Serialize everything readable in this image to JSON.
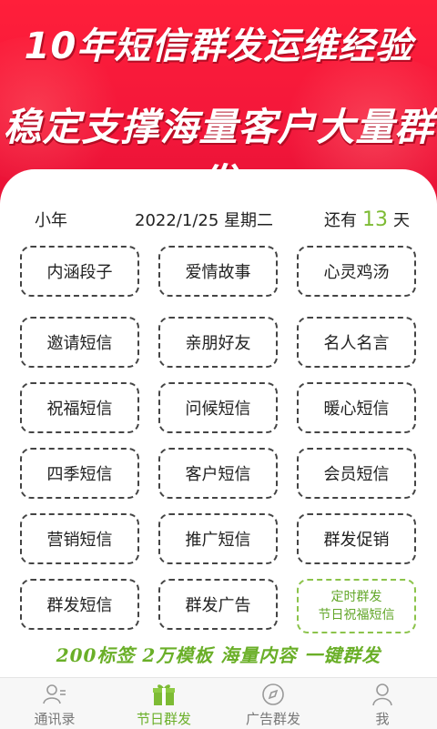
{
  "banner": {
    "line1": "10年短信群发运维经验",
    "line2": "稳定支撑海量客户大量群发"
  },
  "date_row": {
    "festival": "小年",
    "date": "2022/1/25 星期二",
    "days_prefix": "还有",
    "days_count": "13",
    "days_suffix": "天"
  },
  "categories": [
    {
      "label": "内涵段子"
    },
    {
      "label": "爱情故事"
    },
    {
      "label": "心灵鸡汤"
    },
    {
      "label": "邀请短信"
    },
    {
      "label": "亲朋好友"
    },
    {
      "label": "名人名言"
    },
    {
      "label": "祝福短信"
    },
    {
      "label": "问候短信"
    },
    {
      "label": "暖心短信"
    },
    {
      "label": "四季短信"
    },
    {
      "label": "客户短信"
    },
    {
      "label": "会员短信"
    },
    {
      "label": "营销短信"
    },
    {
      "label": "推广短信"
    },
    {
      "label": "群发促销"
    },
    {
      "label": "群发短信"
    },
    {
      "label": "群发广告"
    }
  ],
  "scheduled": {
    "line1": "定时群发",
    "line2": "节日祝福短信"
  },
  "tagline": "200标签  2万模板  海量内容  一键群发",
  "tabs": [
    {
      "label": "通讯录",
      "icon": "contacts-icon"
    },
    {
      "label": "节日群发",
      "icon": "gift-icon"
    },
    {
      "label": "广告群发",
      "icon": "compass-icon"
    },
    {
      "label": "我",
      "icon": "user-icon"
    }
  ],
  "colors": {
    "banner_red": "#f2163a",
    "accent_green": "#6aaf28"
  }
}
